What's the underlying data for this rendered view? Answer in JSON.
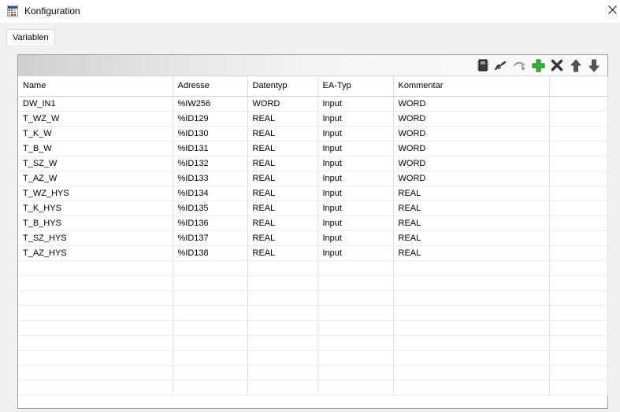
{
  "window": {
    "title": "Konfiguration",
    "close_symbol": "✕"
  },
  "tabs": [
    {
      "label": "Variablen",
      "active": true
    }
  ],
  "toolbar": {
    "buttons": [
      {
        "icon": "memory-card-icon"
      },
      {
        "icon": "link-icon"
      },
      {
        "icon": "unlink-icon"
      },
      {
        "icon": "add-icon",
        "color": "#2eb82e"
      },
      {
        "icon": "delete-icon"
      },
      {
        "icon": "arrow-up-icon"
      },
      {
        "icon": "arrow-down-icon"
      }
    ]
  },
  "table": {
    "columns": [
      "Name",
      "Adresse",
      "Datentyp",
      "EA-Typ",
      "Kommentar",
      ""
    ],
    "rows": [
      [
        "DW_IN1",
        "%IW256",
        "WORD",
        "Input",
        "WORD"
      ],
      [
        "T_WZ_W",
        "%ID129",
        "REAL",
        "Input",
        "WORD"
      ],
      [
        "T_K_W",
        "%ID130",
        "REAL",
        "Input",
        "WORD"
      ],
      [
        "T_B_W",
        "%ID131",
        "REAL",
        "Input",
        "WORD"
      ],
      [
        "T_SZ_W",
        "%ID132",
        "REAL",
        "Input",
        "WORD"
      ],
      [
        "T_AZ_W",
        "%ID133",
        "REAL",
        "Input",
        "WORD"
      ],
      [
        "T_WZ_HYS",
        "%ID134",
        "REAL",
        "Input",
        "REAL"
      ],
      [
        "T_K_HYS",
        "%ID135",
        "REAL",
        "Input",
        "REAL"
      ],
      [
        "T_B_HYS",
        "%ID136",
        "REAL",
        "Input",
        "REAL"
      ],
      [
        "T_SZ_HYS",
        "%ID137",
        "REAL",
        "Input",
        "REAL"
      ],
      [
        "T_AZ_HYS",
        "%ID138",
        "REAL",
        "Input",
        "REAL"
      ]
    ]
  }
}
